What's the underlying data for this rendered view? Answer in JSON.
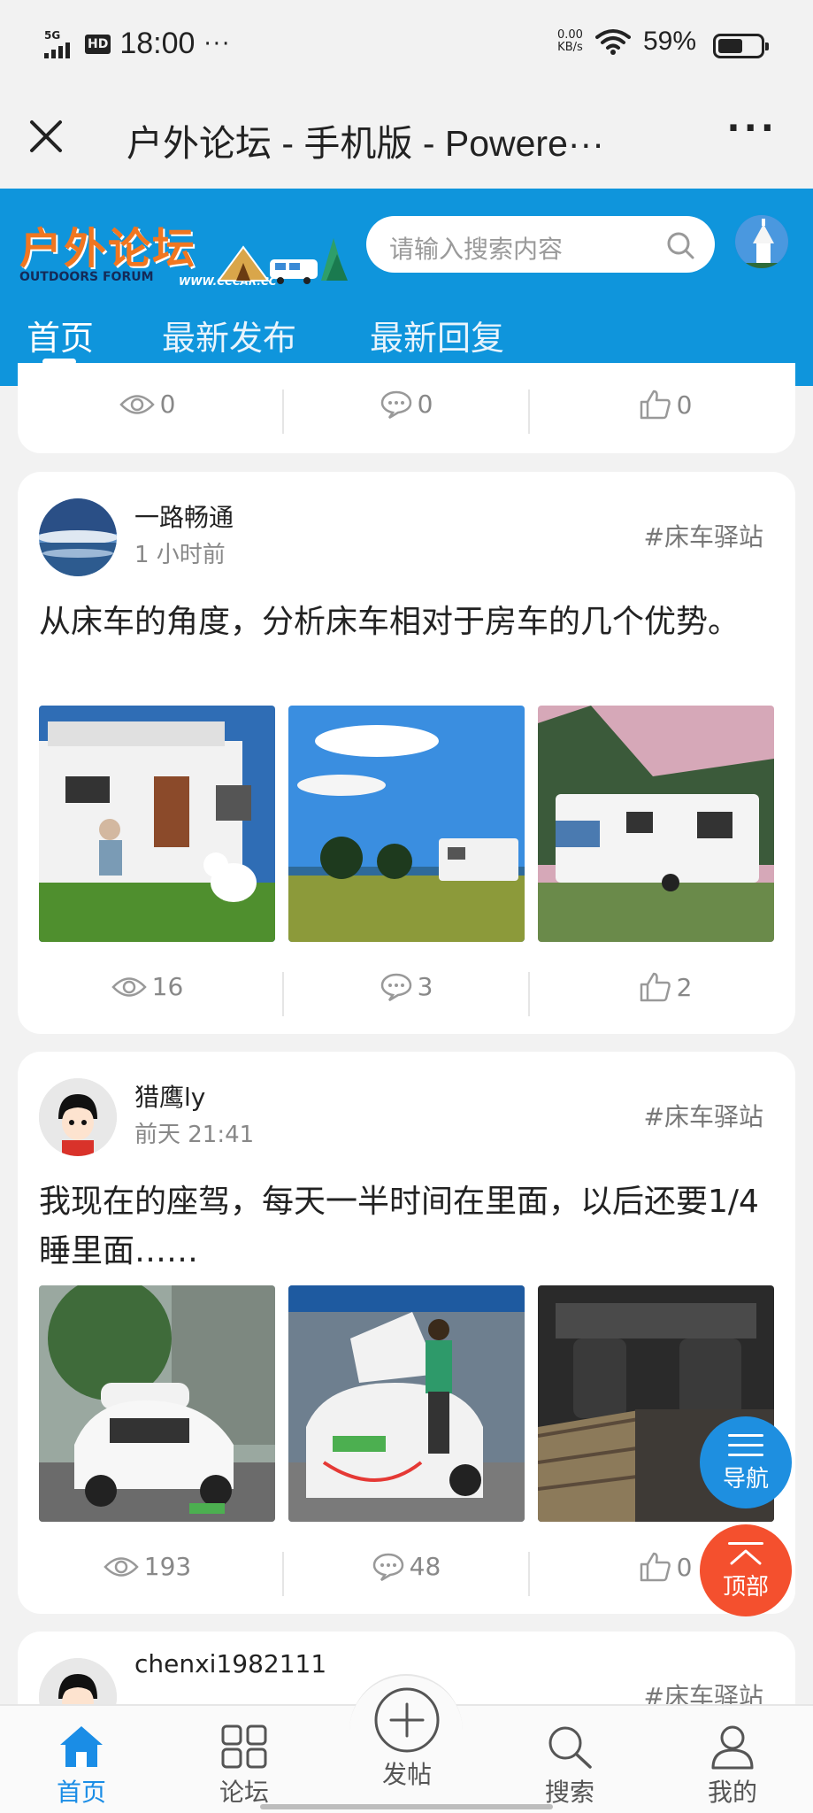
{
  "status_bar": {
    "network": "5G",
    "hd": "HD",
    "time": "18:00",
    "more": "···",
    "net_speed_value": "0.00",
    "net_speed_unit": "KB/s",
    "battery": "59%",
    "battery_level": 0.59
  },
  "browser": {
    "title": "户外论坛 - 手机版 - Powere···",
    "close_icon": "close-icon",
    "more_icon": "more-icon"
  },
  "site": {
    "logo_text": "户外论坛",
    "logo_en": "OUTDOORS FORUM",
    "logo_url": "WWW.CCCAR.CC",
    "search_placeholder": "请输入搜索内容",
    "tabs": [
      {
        "label": "首页",
        "active": true
      },
      {
        "label": "最新发布",
        "active": false
      },
      {
        "label": "最新回复",
        "active": false
      }
    ]
  },
  "posts": [
    {
      "partial": true,
      "views": "0",
      "comments": "0",
      "likes": "0"
    },
    {
      "author": "一路畅通",
      "time": "1 小时前",
      "tag": "#床车驿站",
      "text": "从床车的角度，分析床车相对于房车的几个优势。",
      "views": "16",
      "comments": "3",
      "likes": "2"
    },
    {
      "author": "猎鹰ly",
      "time": "前天 21:41",
      "tag": "#床车驿站",
      "text": "我现在的座驾，每天一半时间在里面，以后还要1/4睡里面……",
      "views": "193",
      "comments": "48",
      "likes": "0"
    },
    {
      "author": "chenxi1982111",
      "tag": "#床车驿站"
    }
  ],
  "floating": {
    "nav_label": "导航",
    "top_label": "顶部"
  },
  "bottom_nav": [
    {
      "label": "首页",
      "icon": "home-icon",
      "active": true
    },
    {
      "label": "论坛",
      "icon": "grid-icon",
      "active": false
    },
    {
      "label": "发帖",
      "icon": "plus-icon",
      "active": false
    },
    {
      "label": "搜索",
      "icon": "search-icon",
      "active": false
    },
    {
      "label": "我的",
      "icon": "user-icon",
      "active": false
    }
  ],
  "colors": {
    "brand_blue": "#0f95dc",
    "active_blue": "#1a8de6",
    "top_button": "#f4502e",
    "logo_orange": "#f07620"
  }
}
